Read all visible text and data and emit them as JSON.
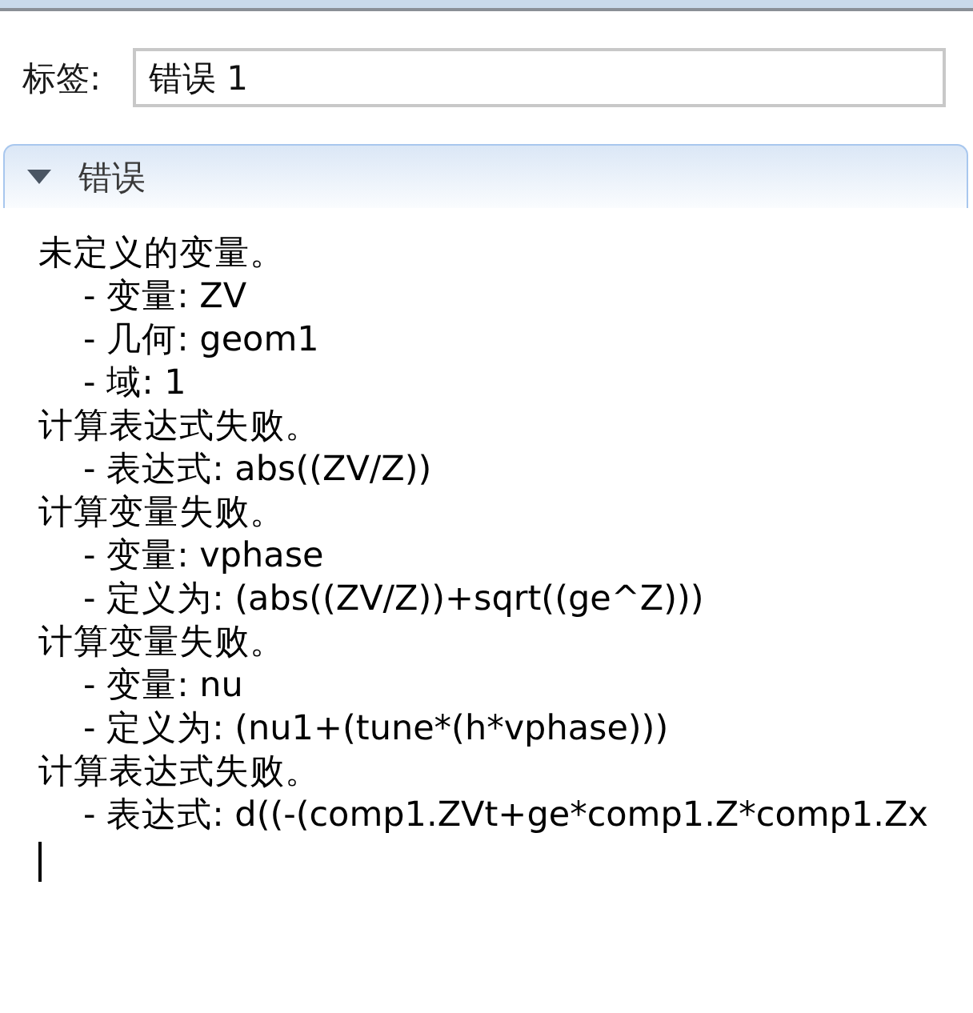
{
  "label_field": {
    "label": "标签:",
    "value": "错误 1"
  },
  "section": {
    "title": "错误",
    "expanded": true
  },
  "log": {
    "focused": true,
    "messages": [
      {
        "text": "未定义的变量。",
        "details": [
          "- 变量: ZV",
          "- 几何: geom1",
          "- 域: 1"
        ]
      },
      {
        "text": "计算表达式失败。",
        "details": [
          "- 表达式: abs((ZV/Z))"
        ]
      },
      {
        "text": "计算变量失败。",
        "details": [
          "- 变量: vphase",
          "- 定义为: (abs((ZV/Z))+sqrt((ge^Z)))"
        ]
      },
      {
        "text": "计算变量失败。",
        "details": [
          "- 变量: nu",
          "- 定义为: (nu1+(tune*(h*vphase)))"
        ]
      },
      {
        "text": "计算表达式失败。",
        "details": [
          "- 表达式: d((-(comp1.ZVt+ge*comp1.Z*comp1.Zx"
        ]
      }
    ]
  }
}
